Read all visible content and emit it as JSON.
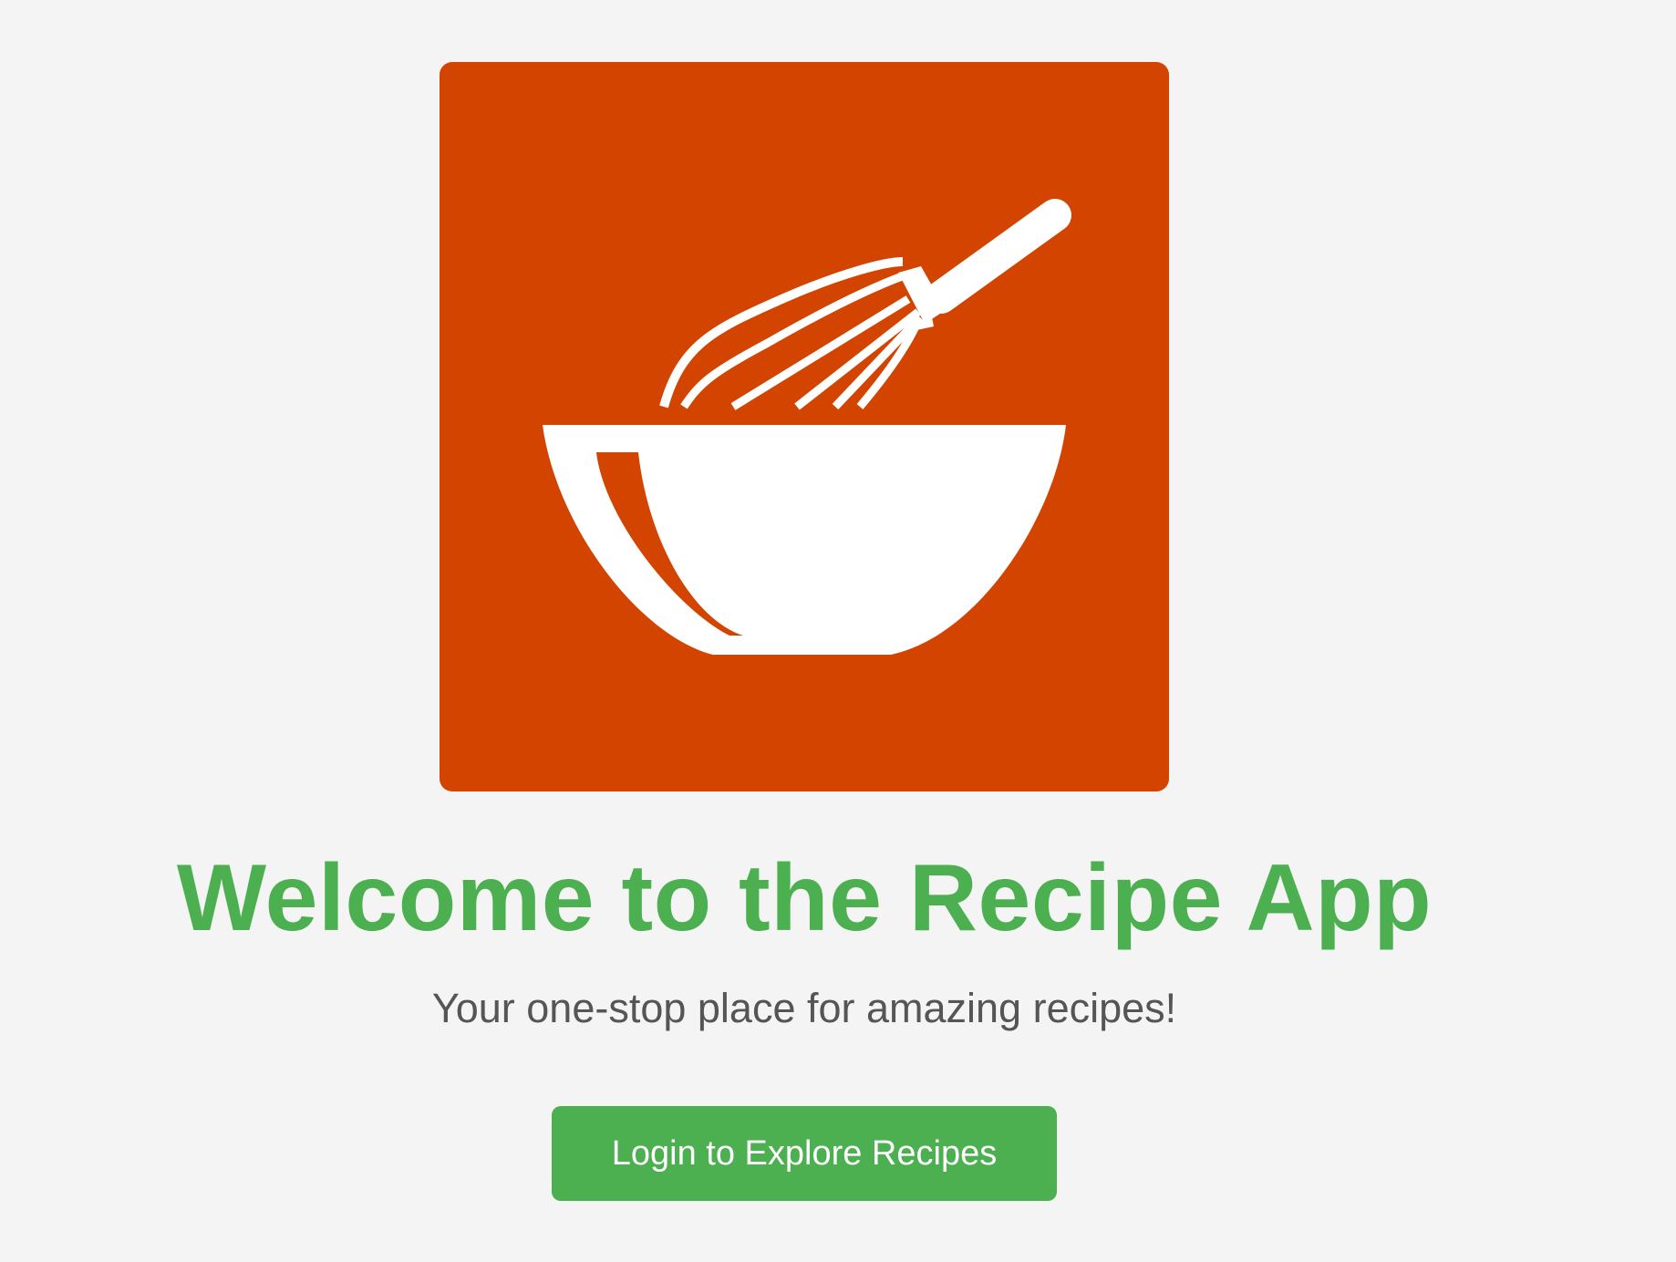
{
  "colors": {
    "background": "#f4f4f4",
    "logo_background": "#d24400",
    "logo_foreground": "#ffffff",
    "accent": "#4caf50",
    "subtitle_text": "#555555",
    "button_text": "#ffffff"
  },
  "logo": {
    "icon": "whisk-bowl-icon"
  },
  "hero": {
    "title": "Welcome to the Recipe App",
    "subtitle": "Your one-stop place for amazing recipes!"
  },
  "actions": {
    "login_label": "Login to Explore Recipes"
  }
}
